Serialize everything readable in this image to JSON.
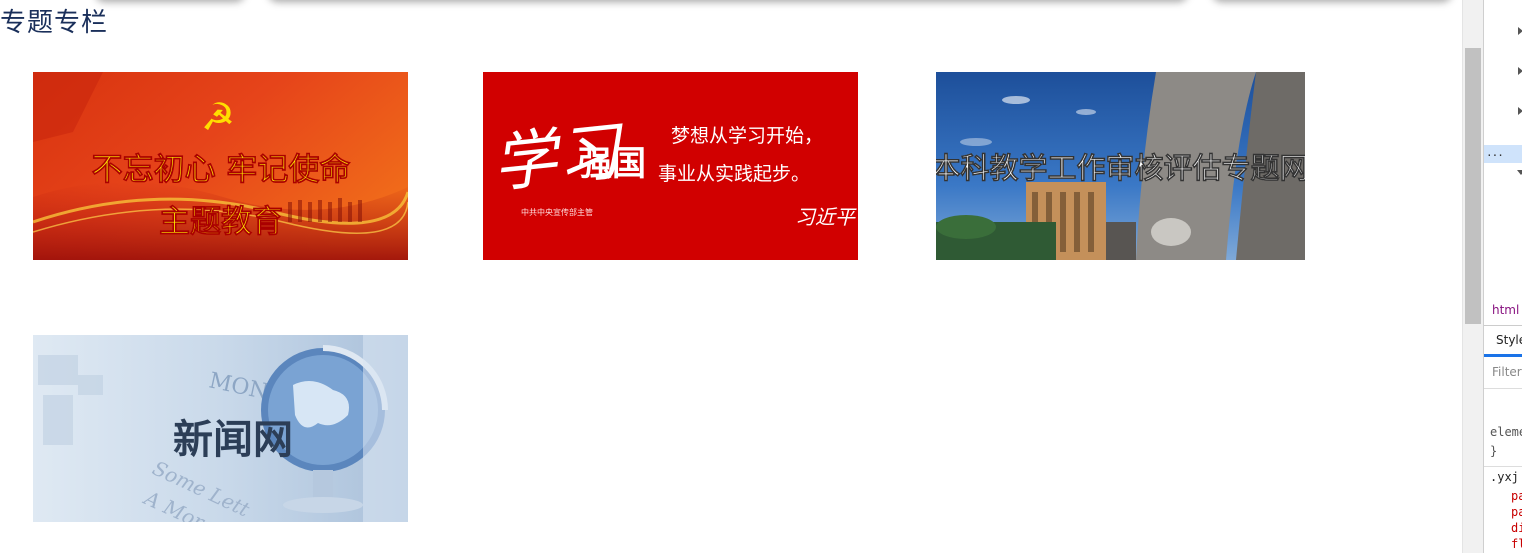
{
  "section": {
    "title": "专题专栏"
  },
  "banners": [
    {
      "name": "主题教育",
      "line1": "不忘初心  牢记使命",
      "line2": "主题教育",
      "emblem": "☭"
    },
    {
      "name": "学习强国",
      "calligraphy": "学习",
      "brand": "强国",
      "slogan1": "梦想从学习开始，",
      "slogan2": "事业从实践起步。",
      "sub": "中共中央宣传部主管",
      "signature": "习近平"
    },
    {
      "name": "本科教学工作审核评估专题网",
      "text": "本科教学工作审核评估专题网"
    },
    {
      "name": "新闻网",
      "text": "新闻网",
      "deco1": "MONEY",
      "deco2": "Some Lett",
      "deco3": "A More"
    }
  ],
  "devtools": {
    "ellipsis": "...",
    "breadcrumb": "html",
    "tab": "Styles",
    "filter": "Filter",
    "code_line1": "eleme",
    "code_line2": "}",
    "code_line3": ".yxj",
    "props": [
      "pa",
      "pa",
      "di",
      "fl"
    ]
  }
}
